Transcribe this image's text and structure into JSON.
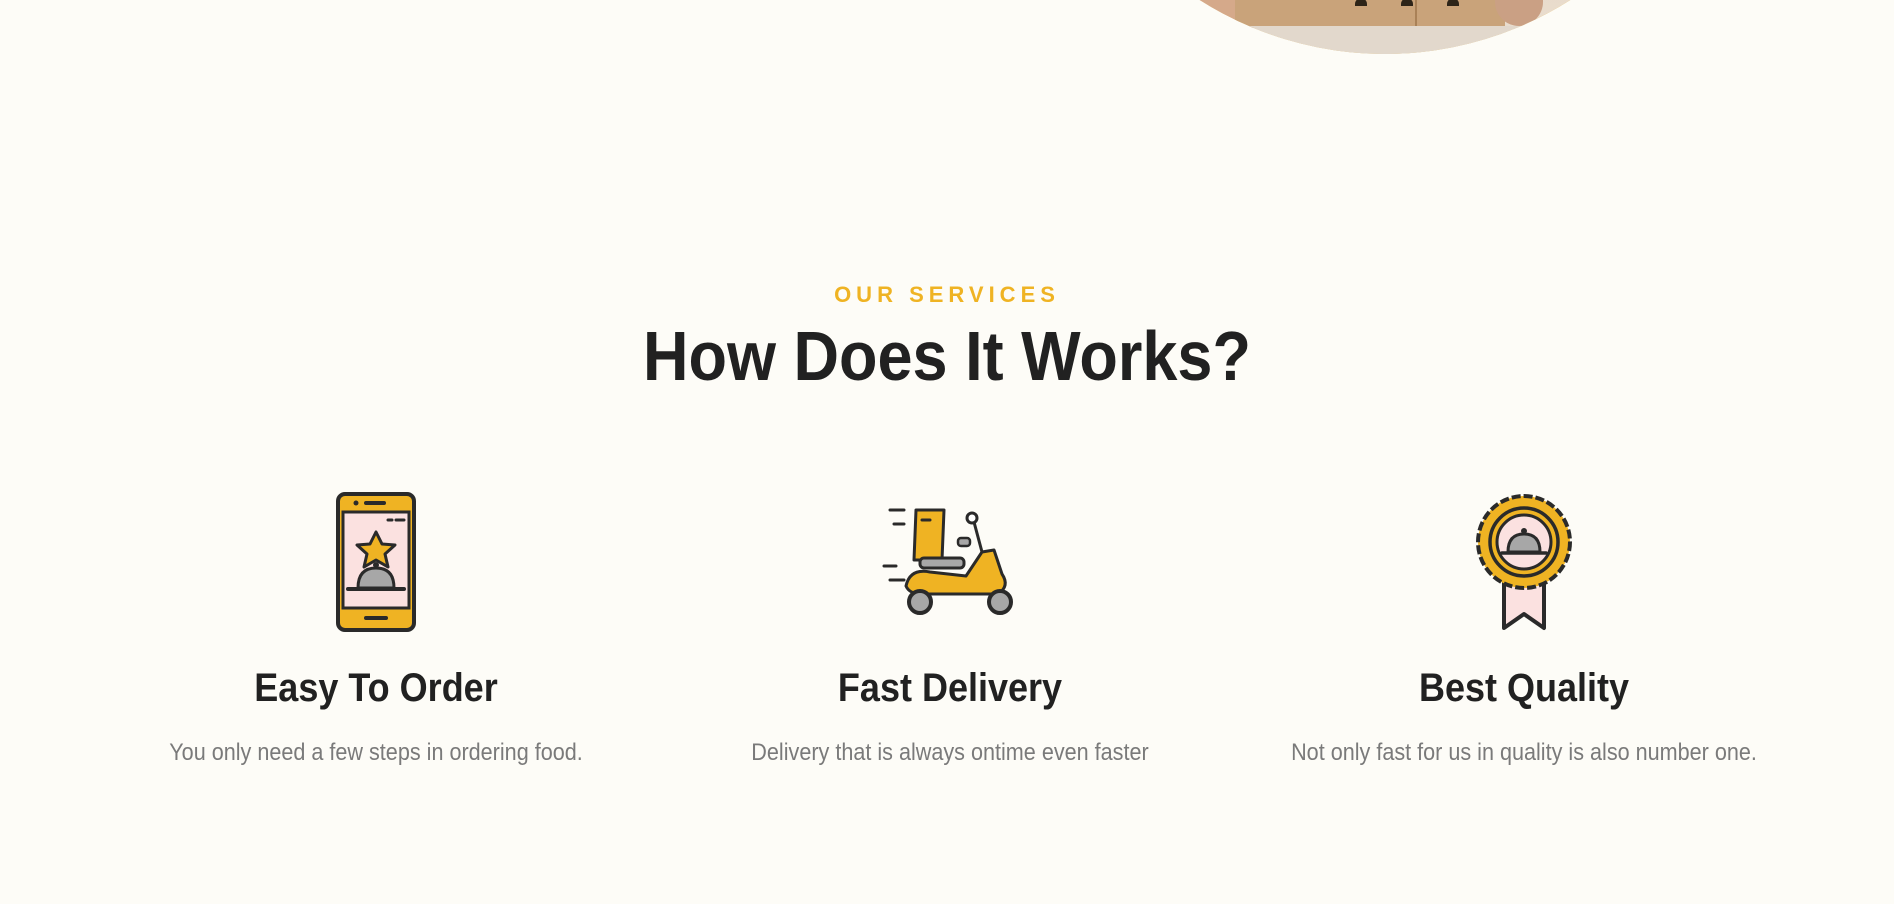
{
  "hero": {
    "image": "delivery-person-holding-box"
  },
  "section": {
    "eyebrow": "OUR SERVICES",
    "heading": "How Does It Works?"
  },
  "services": [
    {
      "icon": "phone-order-icon",
      "title": "Easy To Order",
      "description": "You only need a few steps in ordering food."
    },
    {
      "icon": "scooter-delivery-icon",
      "title": "Fast Delivery",
      "description": "Delivery that is always ontime even faster"
    },
    {
      "icon": "quality-badge-icon",
      "title": "Best Quality",
      "description": "Not only fast for us in quality is also number one."
    }
  ],
  "colors": {
    "accent": "#efb323",
    "background": "#fdfcf7",
    "heading": "#212121",
    "text_muted": "#7a7a7a",
    "icon_pink": "#fbe1e0"
  }
}
